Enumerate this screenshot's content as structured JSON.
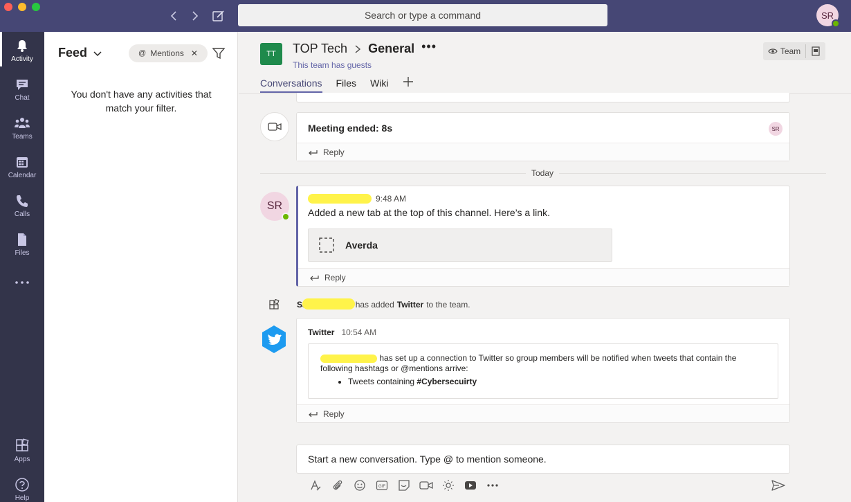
{
  "topbar": {
    "search_placeholder": "Search or type a command",
    "avatar_initials": "SR",
    "colors": {
      "bar": "#464775",
      "close": "#ff5f57",
      "minimize": "#febc2e",
      "maximize": "#28c840"
    }
  },
  "appbar": {
    "items": [
      {
        "label": "Activity",
        "icon": "bell-icon",
        "active": true
      },
      {
        "label": "Chat",
        "icon": "chat-icon"
      },
      {
        "label": "Teams",
        "icon": "teams-icon"
      },
      {
        "label": "Calendar",
        "icon": "calendar-icon"
      },
      {
        "label": "Calls",
        "icon": "phone-icon"
      },
      {
        "label": "Files",
        "icon": "file-icon"
      },
      {
        "label": "...",
        "icon": "more-icon"
      }
    ],
    "apps_label": "Apps",
    "help_label": "Help"
  },
  "feed": {
    "title": "Feed",
    "filter_pill": "Mentions",
    "empty_message": "You don't have any activities that match your filter."
  },
  "channel": {
    "team_badge": "TT",
    "team_name": "TOP Tech",
    "channel_name": "General",
    "guests_note": "This team has guests",
    "tabs": [
      "Conversations",
      "Files",
      "Wiki"
    ],
    "team_button": "Team",
    "accent": "#6264a7"
  },
  "conversation": {
    "meeting_text": "Meeting ended: 8s",
    "meeting_avatar": "SR",
    "reply_label": "Reply",
    "date_divider": "Today",
    "post": {
      "author_avatar": "SR",
      "time": "9:48 AM",
      "body": "Added a new tab at the top of this channel. Here’s a link.",
      "tab_card": "Averda"
    },
    "system_event": {
      "prefix": "Samer",
      "middle": "has added",
      "app": "Twitter",
      "suffix": "to the team."
    },
    "twitter": {
      "name": "Twitter",
      "time": "10:54 AM",
      "body": "has set up a connection to Twitter so group members will be notified when tweets that contain the following hashtags or @mentions arrive:",
      "bullet_prefix": "Tweets containing",
      "hashtag": "#Cybersecuirty"
    }
  },
  "composer": {
    "placeholder": "Start a new conversation. Type @ to mention someone."
  }
}
